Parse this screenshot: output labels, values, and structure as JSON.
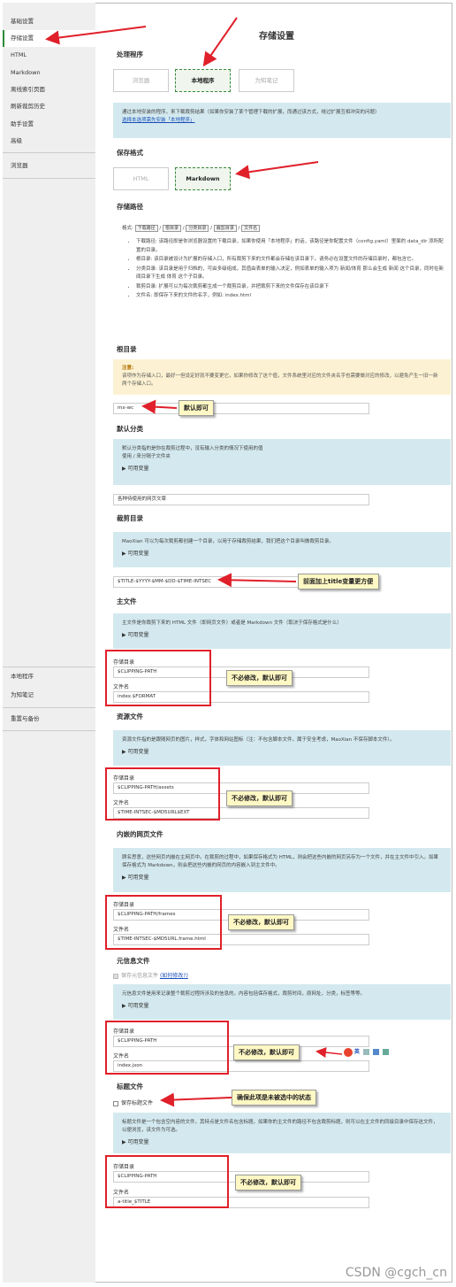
{
  "sidebar": {
    "items": [
      "基础设置",
      "存储设置",
      "HTML",
      "Markdown",
      "离线索引页面",
      "刷新裁剪历史",
      "助手设置",
      "高级",
      "浏览器"
    ],
    "items2": [
      "本地程序",
      "为知笔记",
      "重置与备份"
    ]
  },
  "main": {
    "title": "存储设置",
    "handler": {
      "heading": "处理程序",
      "buttons": [
        "浏览器",
        "本地程序",
        "为知笔记"
      ],
      "info": "通过本地安装的程序，来下载裁剪结果（如果你安装了某个管理下载的扩展，而通过该方式，绕过扩展互相冲突的问题）",
      "link": "选择本选项需先安装「本地程序」"
    },
    "format": {
      "heading": "保存格式",
      "buttons": [
        "HTML",
        "Markdown"
      ]
    },
    "path": {
      "heading": "存储路径",
      "format_label": "格式:",
      "format_codes": [
        "下载路径",
        "根目录",
        "分类目录",
        "裁剪目录",
        "文件名"
      ],
      "bullets": [
        "下载路径:  该路径即是你浏览器设置的下载目录，如果你使用「本地程序」的话，该路径是你配置文件（config.yaml）里面的 data_dir 添所配置的目录。",
        "根目录:  该目录被设计为扩展的存储入口，所有裁剪下来的文件都会存储在该目录下。请务必在设置文件的存储目录时，都包含它。",
        "分类目录:  该目录是用于归档的，可由多级组成，其值由表单的输入决定，例如表单的输入项为 新闻/体育 那么会生成 新闻 这个目录，同时在新闻目录下生成 体育 这个子目录。",
        "裁剪目录:  扩展可以为每次裁剪都生成一个裁剪目录，并把裁剪下来的文件保存在该目录下",
        "文件名:  即保存下来的文件的名字，例如: index.html"
      ]
    },
    "root": {
      "heading": "根目录",
      "warn_title": "注意:",
      "warn": "该项作为存储入口，最好一但设定好就不要变更它，如果你修改了这个值，文件系统里对应的文件夹名字也需要做对应的修改，以避免产生一旧一新两个存储入口。",
      "value": "mx-wc"
    },
    "category": {
      "heading": "默认分类",
      "info": "默认分类指的是你在裁剪过程中，没有输入分类的情况下使用的值",
      "info2": "使用 / 来分隔子文件夹",
      "toggle": "▶ 可用变量",
      "value": "各种待使用的网页文章"
    },
    "clipdir": {
      "heading": "裁剪目录",
      "info": "MaoXian 可以为每次裁剪都创建一个目录，以用于存储裁剪结果，我们把这个目录叫做裁剪目录。",
      "toggle": "▶ 可用变量",
      "value": "$TITLE-$YYYY-$MM-$DD-$TIME-INTSEC"
    },
    "mainfile": {
      "heading": "主文件",
      "info": "主文件是你裁剪下来的 HTML 文件（即网页文件）或者是 Markdown 文件（取决于保存格式是什么）",
      "toggle": "▶ 可用变量",
      "dir_label": "存储目录",
      "dir": "$CLIPPING-PATH",
      "name_label": "文件名",
      "name": "index.$FORMAT"
    },
    "assets": {
      "heading": "资源文件",
      "info": "资源文件指的是跟随网页的图片，样式，字体和网站图标（注：不包含脚本文件，属于安全考虑，MaoXian 不保存脚本文件）。",
      "toggle": "▶ 可用变量",
      "dir_label": "存储目录",
      "dir": "$CLIPPING-PATH/assets",
      "name_label": "文件名",
      "name": "$TIME-INTSEC-$MD5URL$EXT"
    },
    "frames": {
      "heading": "内嵌的网页文件",
      "info": "顾名思意，这些网页内嵌在主网页中。在裁剪的过程中，如果保存格式为 HTML，则会把这些内嵌的网页另存为一个文件，并在主文件中引入。如果保存格式为 Markdown，则会把这些内嵌的网页的内容嵌入到主文件中。",
      "toggle": "▶ 可用变量",
      "dir_label": "存储目录",
      "dir": "$CLIPPING-PATH/frames",
      "name_label": "文件名",
      "name": "$TIME-INTSEC-$MD5URL.frame.html"
    },
    "meta": {
      "heading": "元信息文件",
      "checkbox": "保存元信息文件",
      "checkbox_link": "(如何修改?)",
      "info": "元信息文件是用来记录整个裁剪过程所涉及的信息的，内容包括保存格式，裁剪时间，原网址，分类，标签等等。",
      "toggle": "▶ 可用变量",
      "dir_label": "存储目录",
      "dir": "$CLIPPING-PATH",
      "name_label": "文件名",
      "name": "index.json"
    },
    "titlefile": {
      "heading": "标题文件",
      "checkbox": "保存标题文件",
      "info": "标题文件是一个包含空内容的文件，其特点是文件名包含标题。如果你的主文件的路径不包含裁剪标题，则可以在主文件的同级目录中保存这文件，以便浏览，该文件为可选。",
      "toggle": "▶ 可用变量",
      "dir_label": "存储目录",
      "dir": "$CLIPPING-PATH",
      "name_label": "文件名",
      "name": "a-title_$TITLE"
    }
  },
  "notes": {
    "default_ok": "默认即可",
    "add_title": "前面加上title变量更方便",
    "no_change": "不必修改，默认即可",
    "ensure_unchecked": "确保此项是未被选中的状态"
  },
  "ime": "英",
  "watermark": "CSDN @cgch_cn"
}
